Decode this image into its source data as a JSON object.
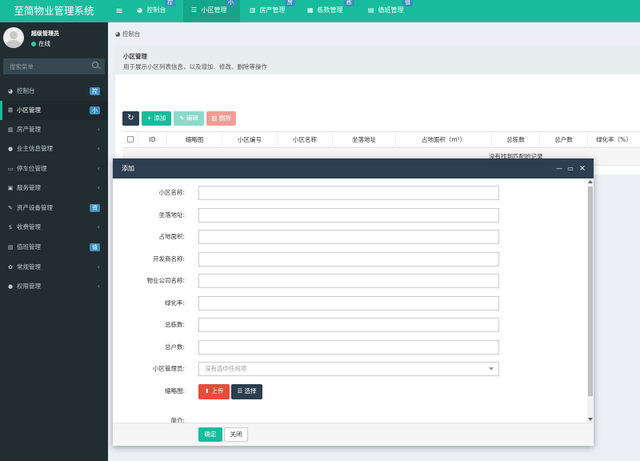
{
  "app": {
    "title": "至简物业管理系统"
  },
  "topnav": {
    "menu_icon": "≡",
    "tabs": [
      {
        "label": "控制台",
        "icon": "dashboard-icon",
        "glyph": "◕",
        "badge": "控"
      },
      {
        "label": "小区管理",
        "icon": "list-icon",
        "glyph": "☰",
        "badge": "小"
      },
      {
        "label": "房产管理",
        "icon": "building-icon",
        "glyph": "▥",
        "badge": "房"
      },
      {
        "label": "栋数管理",
        "icon": "grid-icon",
        "glyph": "▦",
        "badge": "栋"
      },
      {
        "label": "值班管理",
        "icon": "calendar-icon",
        "glyph": "▤",
        "badge": "值"
      }
    ]
  },
  "user": {
    "name": "超级管理员",
    "status": "在线"
  },
  "sidebar": {
    "search_placeholder": "搜索菜单",
    "items": [
      {
        "label": "控制台",
        "icon": "dashboard-icon",
        "glyph": "◕",
        "badge": "控",
        "chevron": ""
      },
      {
        "label": "小区管理",
        "icon": "list-icon",
        "glyph": "☰",
        "badge": "小",
        "chevron": ""
      },
      {
        "label": "房产管理",
        "icon": "building-icon",
        "glyph": "▥",
        "badge": "",
        "chevron": "‹"
      },
      {
        "label": "业主信息管理",
        "icon": "user-icon",
        "glyph": "●",
        "badge": "",
        "chevron": "‹"
      },
      {
        "label": "停车位管理",
        "icon": "car-icon",
        "glyph": "▭",
        "badge": "",
        "chevron": "‹"
      },
      {
        "label": "服务管理",
        "icon": "briefcase-icon",
        "glyph": "▣",
        "badge": "",
        "chevron": "‹"
      },
      {
        "label": "资产设备管理",
        "icon": "wrench-icon",
        "glyph": "✎",
        "badge": "资",
        "chevron": ""
      },
      {
        "label": "收费管理",
        "icon": "dollar-icon",
        "glyph": "$",
        "badge": "",
        "chevron": "‹"
      },
      {
        "label": "值班管理",
        "icon": "calendar-icon",
        "glyph": "▤",
        "badge": "值",
        "chevron": ""
      },
      {
        "label": "常规管理",
        "icon": "cogs-icon",
        "glyph": "✿",
        "badge": "",
        "chevron": "‹"
      },
      {
        "label": "权限管理",
        "icon": "users-icon",
        "glyph": "●",
        "badge": "",
        "chevron": "‹"
      }
    ]
  },
  "breadcrumb": {
    "icon": "◕",
    "label": "控制台"
  },
  "panel": {
    "title": "小区管理",
    "description": "用于展示小区列表信息，以及增加、修改、删除等操作"
  },
  "toolbar": {
    "refresh_glyph": "↻",
    "add_label": "+ 添加",
    "edit_label": "✎ 编辑",
    "delete_label": "▥ 删除"
  },
  "table": {
    "columns": [
      "ID",
      "缩略图",
      "小区编号",
      "小区名称",
      "坐落地址",
      "占地面积（m²）",
      "总栋数",
      "总户数",
      "绿化率（%）"
    ],
    "empty_text": "没有找到匹配的记录"
  },
  "modal": {
    "title": "添加",
    "controls": {
      "minimize": "—",
      "maximize": "▭",
      "close": "×"
    },
    "fields": [
      {
        "label": "小区名称:",
        "value": ""
      },
      {
        "label": "坐落地址:",
        "value": ""
      },
      {
        "label": "占地面积:",
        "value": ""
      },
      {
        "label": "开发商名称:",
        "value": ""
      },
      {
        "label": "物业公司名称:",
        "value": ""
      },
      {
        "label": "绿化率:",
        "value": ""
      },
      {
        "label": "总栋数:",
        "value": ""
      },
      {
        "label": "总户数:",
        "value": ""
      }
    ],
    "manager": {
      "label": "小区管理员:",
      "placeholder": "没有选中任何项"
    },
    "thumbnail": {
      "label": "缩略图:",
      "upload_label": "⬆ 上传",
      "choose_label": "☰ 选择"
    },
    "cut_label": "简介:",
    "confirm_label": "确定",
    "close_label": "关闭"
  },
  "colors": {
    "primary": "#18bc9c",
    "sidebar": "#222d32",
    "modal_header": "#2c3e50",
    "danger": "#e74c3c",
    "badge": "#3c8dbc"
  }
}
